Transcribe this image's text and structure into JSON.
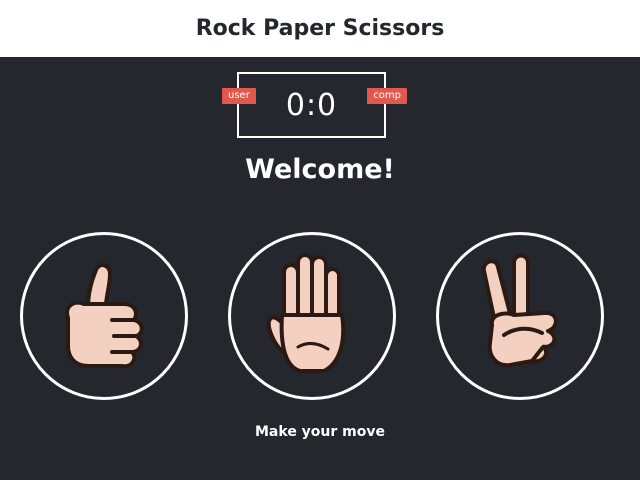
{
  "header": {
    "title": "Rock Paper Scissors"
  },
  "scoreboard": {
    "score": "0:0",
    "user_label": "user",
    "comp_label": "comp"
  },
  "message": "Welcome!",
  "choices": [
    {
      "id": "rock",
      "icon": "thumbs-up-hand-icon"
    },
    {
      "id": "paper",
      "icon": "open-palm-hand-icon"
    },
    {
      "id": "scissors",
      "icon": "peace-sign-hand-icon"
    }
  ],
  "prompt": "Make your move",
  "colors": {
    "background": "#25272e",
    "header_bg": "#ffffff",
    "badge": "#e2584d",
    "skin": "#f3d0bf",
    "outline": "#2b1a14"
  }
}
